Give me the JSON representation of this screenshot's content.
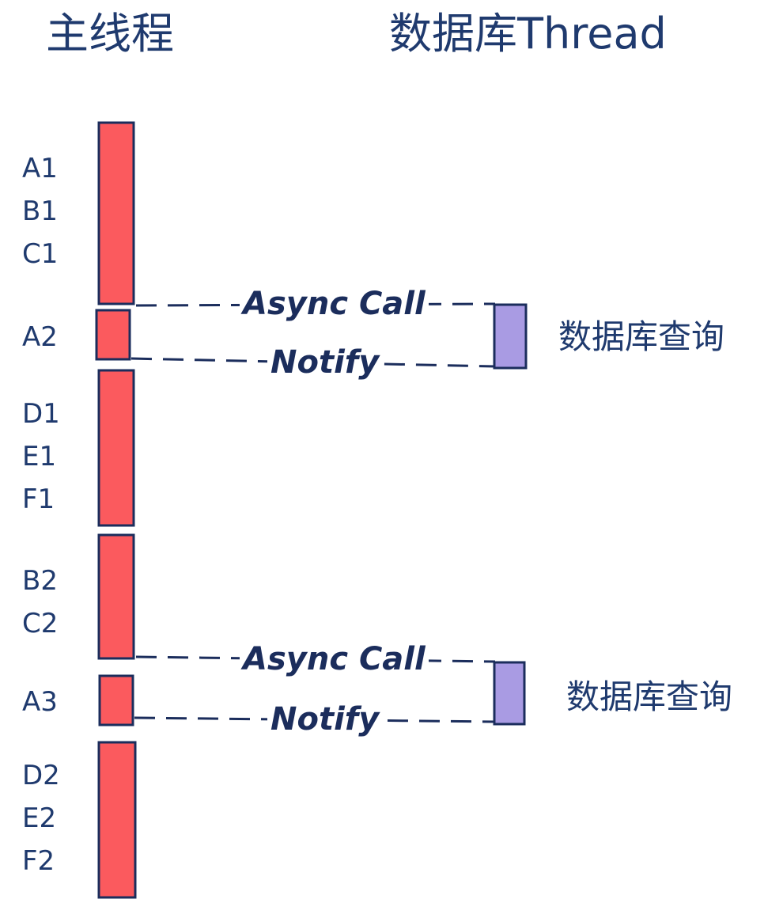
{
  "headers": {
    "main_thread": "主线程",
    "db_thread": "数据库Thread"
  },
  "task_labels": [
    "A1",
    "B1",
    "C1",
    "A2",
    "D1",
    "E1",
    "F1",
    "B2",
    "C2",
    "A3",
    "D2",
    "E2",
    "F2"
  ],
  "exchanges": [
    {
      "call_label": "Async Call",
      "notify_label": "Notify",
      "db_label": "数据库查询"
    },
    {
      "call_label": "Async Call",
      "notify_label": "Notify",
      "db_label": "数据库查询"
    }
  ],
  "colors": {
    "main_block": "#fb5a5e",
    "db_block": "#a99be3",
    "outline": "#1b2d5c",
    "text": "#1f3a6e"
  }
}
